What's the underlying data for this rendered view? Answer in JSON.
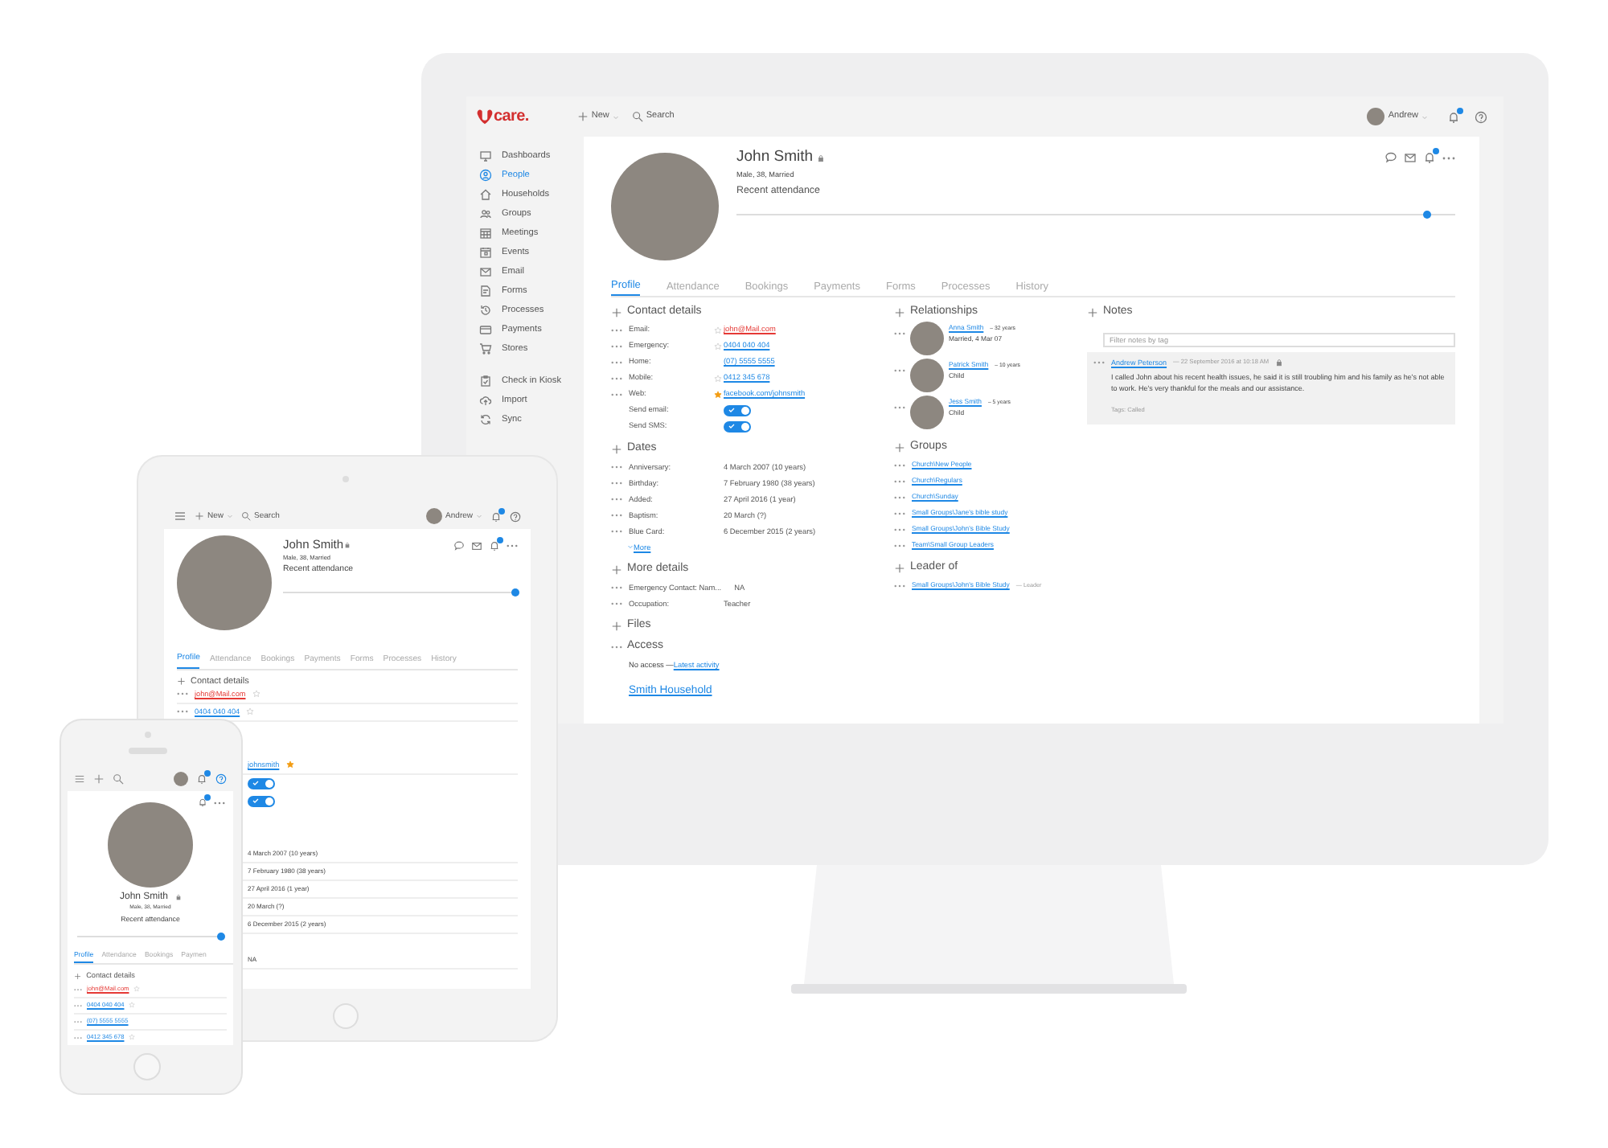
{
  "desktop": {
    "logo_text": "care.",
    "topbar": {
      "new_label": "New",
      "search_label": "Search",
      "user": "Andrew"
    },
    "sidebar": {
      "main": [
        {
          "label": "Dashboards",
          "selected": false
        },
        {
          "label": "People",
          "selected": true
        },
        {
          "label": "Households",
          "selected": false
        },
        {
          "label": "Groups",
          "selected": false
        },
        {
          "label": "Meetings",
          "selected": false
        },
        {
          "label": "Events",
          "selected": false
        },
        {
          "label": "Email",
          "selected": false
        },
        {
          "label": "Forms",
          "selected": false
        },
        {
          "label": "Processes",
          "selected": false
        },
        {
          "label": "Payments",
          "selected": false
        },
        {
          "label": "Stores",
          "selected": false
        }
      ],
      "tools": [
        {
          "label": "Check in Kiosk",
          "selected": false
        },
        {
          "label": "Import",
          "selected": false
        },
        {
          "label": "Sync",
          "selected": false
        }
      ]
    },
    "profile": {
      "name": "John Smith",
      "subtitle": "Male, 38, Married",
      "attendance_label": "Recent attendance",
      "level": 0.96
    },
    "tabs": [
      {
        "label": "Profile",
        "selected": true
      },
      {
        "label": "Attendance",
        "selected": false
      },
      {
        "label": "Bookings",
        "selected": false
      },
      {
        "label": "Payments",
        "selected": false
      },
      {
        "label": "Forms",
        "selected": false
      },
      {
        "label": "Processes",
        "selected": false
      },
      {
        "label": "History",
        "selected": false
      }
    ],
    "contact_details": {
      "title": "Contact details",
      "rows": [
        {
          "label": "Email:",
          "value": "john@Mail.com",
          "flagged": true,
          "starred": false
        },
        {
          "label": "Emergency:",
          "value": "0404 040 404",
          "flagged": false,
          "starred": false
        },
        {
          "label": "Home:",
          "value": "(07) 5555 5555",
          "flagged": false
        },
        {
          "label": "Mobile:",
          "value": "0412 345 678",
          "flagged": false,
          "starred": false
        },
        {
          "label": "Web:",
          "value": "facebook.com/johnsmith",
          "flagged": false,
          "starred": true
        }
      ],
      "toggles": [
        {
          "label": "Send email:",
          "on": true
        },
        {
          "label": "Send SMS:",
          "on": true
        }
      ]
    },
    "dates": {
      "title": "Dates",
      "rows": [
        {
          "label": "Anniversary:",
          "value": "4 March 2007 (10 years)"
        },
        {
          "label": "Birthday:",
          "value": "7 February 1980 (38 years)"
        },
        {
          "label": "Added:",
          "value": "27 April 2016 (1 year)"
        },
        {
          "label": "Baptism:",
          "value": "20 March (?)"
        },
        {
          "label": "Blue Card:",
          "value": "6 December 2015 (2 years)"
        }
      ],
      "more": "More"
    },
    "more_details": {
      "title": "More details",
      "rows": [
        {
          "label": "Emergency Contact: Nam...",
          "value": "NA"
        },
        {
          "label": "Occupation:",
          "value": "Teacher"
        }
      ]
    },
    "files": {
      "title": "Files"
    },
    "access": {
      "title": "Access",
      "text": "No access — ",
      "link": "Latest activity"
    },
    "household": "Smith Household",
    "relationships": {
      "title": "Relationships",
      "people": [
        {
          "name": "Anna Smith",
          "age": "– 32 years",
          "detail": "Married, 4 Mar 07"
        },
        {
          "name": "Patrick Smith",
          "age": "– 10 years",
          "detail": "Child"
        },
        {
          "name": "Jess Smith",
          "age": "– 5 years",
          "detail": "Child"
        }
      ]
    },
    "groups": {
      "title": "Groups",
      "items": [
        "Church\\New People",
        "Church\\Regulars",
        "Church\\Sunday",
        "Small Groups\\Jane's bible study",
        "Small Groups\\John's Bible Study",
        "Team\\Small Group Leaders"
      ]
    },
    "leader_of": {
      "title": "Leader of",
      "items": [
        {
          "name": "Small Groups\\John's Bible Study",
          "role": "— Leader"
        }
      ]
    },
    "notes": {
      "title": "Notes",
      "filter_placeholder": "Filter notes by tag",
      "entries": [
        {
          "author": "Andrew Peterson",
          "time": "— 22 September 2016 at 10:18 AM",
          "text": "I called John about his recent health issues, he said it is still troubling him and his family as he's not able to work. He's very thankful for the meals and our assistance.",
          "tags": "Tags: Called"
        }
      ]
    }
  },
  "tablet": {
    "topbar": {
      "new_label": "New",
      "search_label": "Search",
      "user": "Andrew"
    },
    "profile": {
      "name": "John Smith",
      "subtitle": "Male, 38, Married",
      "attendance_label": "Recent attendance",
      "level": 0.99
    },
    "tabs": [
      {
        "label": "Profile",
        "selected": true
      },
      {
        "label": "Attendance",
        "selected": false
      },
      {
        "label": "Bookings",
        "selected": false
      },
      {
        "label": "Payments",
        "selected": false
      },
      {
        "label": "Forms",
        "selected": false
      },
      {
        "label": "Processes",
        "selected": false
      },
      {
        "label": "History",
        "selected": false
      }
    ],
    "section_title": "Contact details",
    "rows": [
      {
        "kind": "contact",
        "value": "john@Mail.com",
        "flagged": true,
        "starred": false
      },
      {
        "kind": "contact",
        "value": "0404 040 404",
        "flagged": false,
        "starred": false
      },
      {
        "kind": "blank"
      },
      {
        "kind": "blank"
      },
      {
        "kind": "link",
        "value": "johnsmith",
        "starred": true
      },
      {
        "kind": "toggle",
        "on": true
      },
      {
        "kind": "toggle",
        "on": true
      },
      {
        "kind": "blank"
      },
      {
        "kind": "blank"
      },
      {
        "kind": "text",
        "value": "4 March 2007 (10 years)"
      },
      {
        "kind": "text",
        "value": "7 February 1980 (38 years)"
      },
      {
        "kind": "text",
        "value": "27 April 2016 (1 year)"
      },
      {
        "kind": "text",
        "value": "20 March (?)"
      },
      {
        "kind": "text",
        "value": "6 December 2015 (2 years)"
      },
      {
        "kind": "blank"
      },
      {
        "kind": "text",
        "value": "NA"
      }
    ]
  },
  "phone": {
    "profile": {
      "name": "John Smith",
      "subtitle": "Male, 38, Married",
      "attendance_label": "Recent attendance",
      "level": 0.98
    },
    "tabs": [
      {
        "label": "Profile",
        "selected": true
      },
      {
        "label": "Attendance",
        "selected": false
      },
      {
        "label": "Bookings",
        "selected": false
      },
      {
        "label": "Paymen",
        "selected": false
      }
    ],
    "section_title": "Contact details",
    "rows": [
      {
        "kind": "contact",
        "value": "john@Mail.com",
        "flagged": true,
        "starred": false
      },
      {
        "kind": "contact",
        "value": "0404 040 404",
        "flagged": false,
        "starred": false
      },
      {
        "kind": "contact",
        "value": "(07) 5555 5555",
        "flagged": false
      },
      {
        "kind": "contact",
        "value": "0412 345 678",
        "flagged": false,
        "starred": false
      }
    ]
  }
}
